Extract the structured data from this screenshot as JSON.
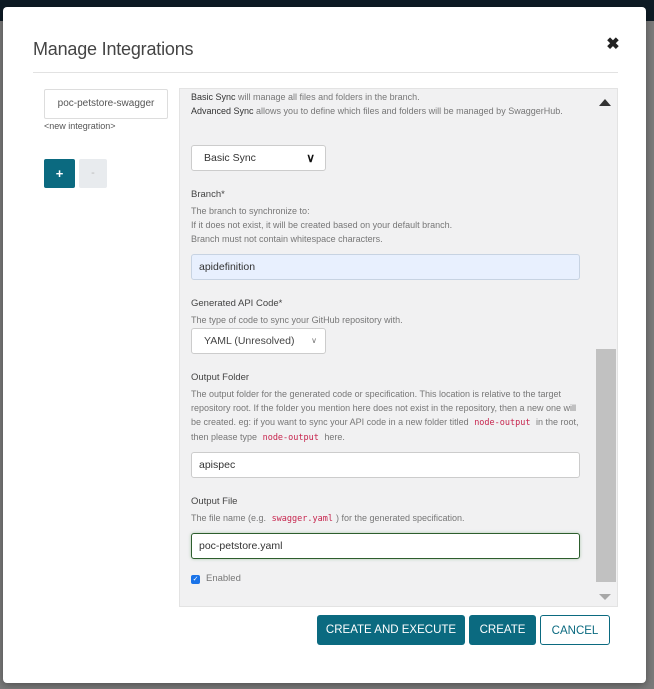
{
  "modal": {
    "title": "Manage Integrations",
    "close_icon": "close-icon"
  },
  "integrations": {
    "items": [
      {
        "label": "poc-petstore-swagger"
      }
    ],
    "new_label": "<new integration>",
    "add_label": "+",
    "remove_label": "-"
  },
  "form": {
    "sync_help_basic_strong": "Basic Sync",
    "sync_help_basic_rest": " will manage all files and folders in the branch.",
    "sync_help_adv_strong": "Advanced Sync",
    "sync_help_adv_rest": " allows you to define which files and folders will be managed by SwaggerHub.",
    "sync_mode": {
      "selected": "Basic Sync"
    },
    "branch": {
      "label": "Branch*",
      "help_1": "The branch to synchronize to:",
      "help_2": "If it does not exist, it will be created based on your default branch.",
      "help_3": "Branch must not contain whitespace characters.",
      "value": "apidefinition"
    },
    "api_code": {
      "label": "Generated API Code*",
      "help": "The type of code to sync your GitHub repository with.",
      "selected": "YAML (Unresolved)"
    },
    "output_folder": {
      "label": "Output Folder",
      "help_1": "The output folder for the generated code or specification. This location is relative to the target repository root. If the folder you mention here does not exist in the repository, then a new one will be created. eg: if you want to sync your API code in a new folder titled",
      "code_1": "node-output",
      "help_2": "in the root, then please type",
      "code_2": "node-output",
      "help_3": "here.",
      "value": "apispec"
    },
    "output_file": {
      "label": "Output File",
      "help_1": "The file name (e.g.",
      "code": "swagger.yaml",
      "help_2": ") for the generated specification.",
      "value": "poc-petstore.yaml"
    },
    "enabled": {
      "label": "Enabled",
      "checked": true
    }
  },
  "footer": {
    "create_execute_label": "CREATE AND EXECUTE",
    "create_label": "CREATE",
    "cancel_label": "CANCEL"
  },
  "colors": {
    "primary": "#0b6a80",
    "code": "#c7254e"
  }
}
